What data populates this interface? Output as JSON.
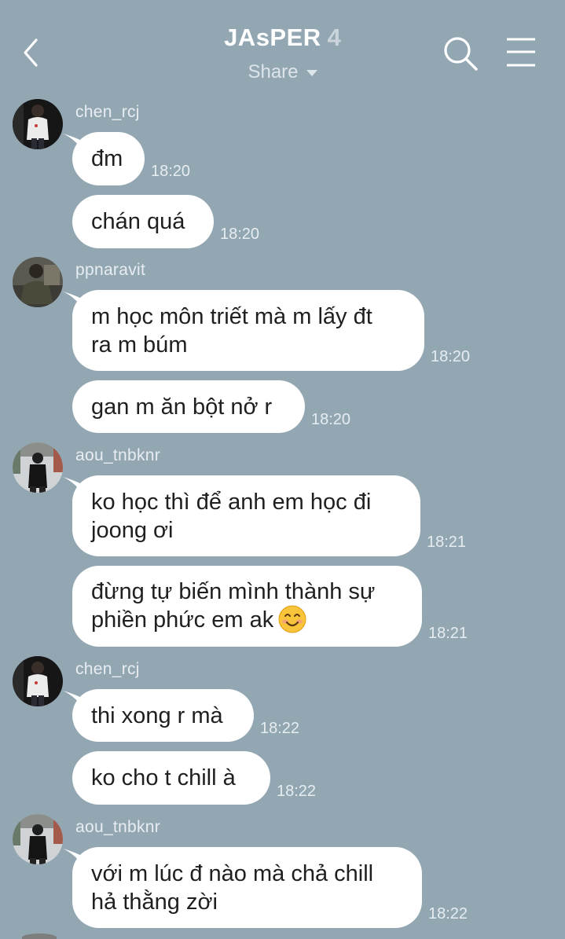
{
  "header": {
    "title": "JAsPER",
    "member_count": "4",
    "subtitle": "Share"
  },
  "icons": {
    "back": "chevron-left-icon",
    "search": "search-icon",
    "menu": "hamburger-menu-icon",
    "emoji": "smiling-face-emoji"
  },
  "colors": {
    "background": "#93a7b3",
    "bubble": "#ffffff",
    "text": "#1f1f1f"
  },
  "messages": [
    {
      "sender": "chen_rcj",
      "text": "đm",
      "time": "18:20"
    },
    {
      "text": "chán quá",
      "time": "18:20"
    },
    {
      "sender": "ppnaravit",
      "text": "m học môn triết mà m lấy đt\nra m búm",
      "time": "18:20"
    },
    {
      "text": "gan m ăn bột nở r",
      "time": "18:20"
    },
    {
      "sender": "aou_tnbknr",
      "text": "ko học thì để anh em học đi\njoong ơi",
      "time": "18:21"
    },
    {
      "text": "đừng tự biến mình thành sự\nphiền phức em ak",
      "time": "18:21"
    },
    {
      "sender": "chen_rcj",
      "text": "thi xong r mà",
      "time": "18:22"
    },
    {
      "text": "ko cho t chill à",
      "time": "18:22"
    },
    {
      "sender": "aou_tnbknr",
      "text": "với m lúc đ nào mà chả chill\nhả thằng zời",
      "time": "18:22"
    }
  ]
}
